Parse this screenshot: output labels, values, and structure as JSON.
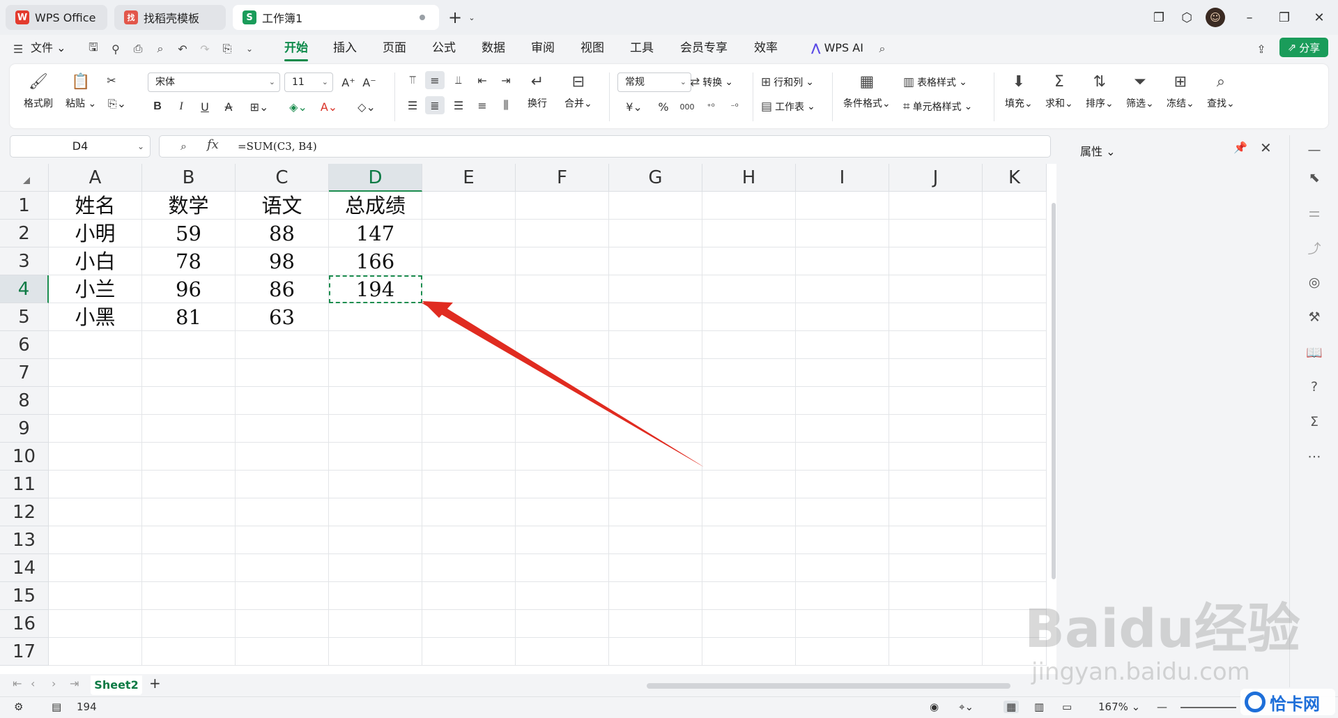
{
  "titlebar": {
    "tabs": [
      {
        "label": "WPS Office",
        "logo": "W"
      },
      {
        "label": "找稻壳模板",
        "logo": "找"
      },
      {
        "label": "工作簿1",
        "logo": "S"
      }
    ],
    "new_tab": "+"
  },
  "menu": {
    "file": "文件",
    "items": [
      "开始",
      "插入",
      "页面",
      "公式",
      "数据",
      "审阅",
      "视图",
      "工具",
      "会员专享",
      "效率"
    ],
    "active": "开始",
    "wps_ai": "WPS AI",
    "share": "分享"
  },
  "ribbon": {
    "format_painter": "格式刷",
    "paste": "粘贴",
    "font_name": "宋体",
    "font_size": "11",
    "wrap": "换行",
    "merge": "合并",
    "number_format": "常规",
    "convert": "转换",
    "rows_cols": "行和列",
    "worksheet": "工作表",
    "conditional_format": "条件格式",
    "table_style": "表格样式",
    "cell_style": "单元格样式",
    "fill": "填充",
    "sum": "求和",
    "sort": "排序",
    "filter": "筛选",
    "freeze": "冻结",
    "find": "查找",
    "bold": "B",
    "italic": "I",
    "underline": "U",
    "currency": "¥",
    "percent": "%",
    "thousands": "000"
  },
  "formula": {
    "cell_ref": "D4",
    "fx": "fx",
    "content": "=SUM(C3, B4)"
  },
  "sheet": {
    "columns": [
      "A",
      "B",
      "C",
      "D",
      "E",
      "F",
      "G",
      "H",
      "I",
      "J",
      "K"
    ],
    "rows": [
      "1",
      "2",
      "3",
      "4",
      "5",
      "6",
      "7",
      "8",
      "9",
      "10",
      "11",
      "12",
      "13",
      "14",
      "15",
      "16",
      "17"
    ],
    "cells": [
      [
        "姓名",
        "数学",
        "语文",
        "总成绩"
      ],
      [
        "小明",
        "59",
        "88",
        "147"
      ],
      [
        "小白",
        "78",
        "98",
        "166"
      ],
      [
        "小兰",
        "96",
        "86",
        "194"
      ],
      [
        "小黑",
        "81",
        "63",
        ""
      ]
    ],
    "selected_col": "D",
    "selected_row": "4"
  },
  "right_panel": {
    "title": "属性"
  },
  "sheet_tabs": {
    "active": "Sheet2",
    "add": "+"
  },
  "status": {
    "value": "194",
    "zoom": "167%"
  },
  "watermark": {
    "brand": "Baidu经验",
    "url": "jingyan.baidu.com",
    "corner": "恰卡网"
  },
  "colors": {
    "accent": "#1c8d4f",
    "arrow": "#e02b20"
  }
}
